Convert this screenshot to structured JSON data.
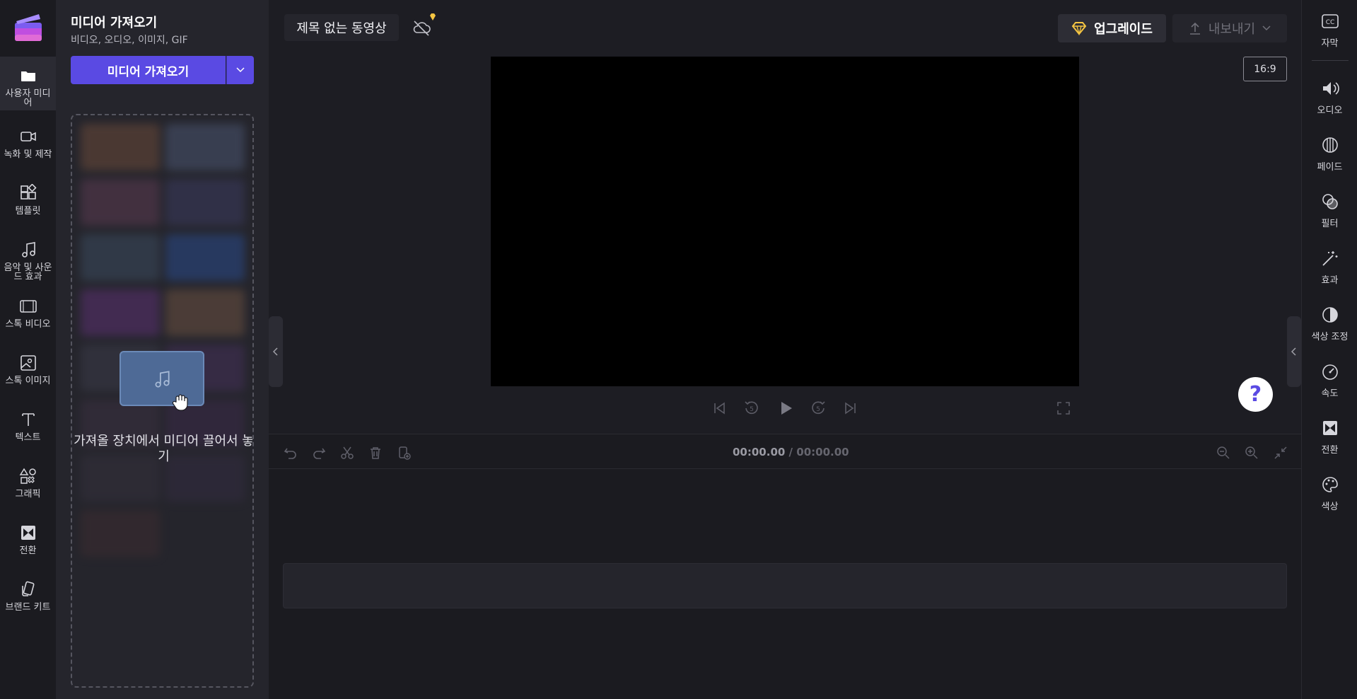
{
  "left_rail": {
    "items": [
      {
        "label": "사용자 미디어",
        "icon": "folder-icon"
      },
      {
        "label": "녹화 및 제작",
        "icon": "video-camera-icon"
      },
      {
        "label": "템플릿",
        "icon": "templates-icon"
      },
      {
        "label": "음악 및 사운드 효과",
        "icon": "music-note-icon"
      },
      {
        "label": "스톡 비디오",
        "icon": "film-icon"
      },
      {
        "label": "스톡 이미지",
        "icon": "image-icon"
      },
      {
        "label": "텍스트",
        "icon": "text-icon"
      },
      {
        "label": "그래픽",
        "icon": "shapes-icon"
      },
      {
        "label": "전환",
        "icon": "transition-icon"
      },
      {
        "label": "브랜드 키트",
        "icon": "brand-kit-icon"
      }
    ]
  },
  "media_panel": {
    "title": "미디어 가져오기",
    "subtitle": "비디오, 오디오, 이미지, GIF",
    "import_button": "미디어 가져오기",
    "drop_text": "가져올 장치에서 미디어 끌어서 놓기"
  },
  "header": {
    "project_title": "제목 없는 동영상",
    "upgrade_label": "업그레이드",
    "export_label": "내보내기"
  },
  "preview": {
    "aspect_ratio": "16:9",
    "help": "?"
  },
  "timeline": {
    "current_time": "00:00.00",
    "separator": " / ",
    "total_time": "00:00.00"
  },
  "right_rail": {
    "items": [
      {
        "label": "자막",
        "icon": "captions-icon"
      },
      {
        "label": "오디오",
        "icon": "speaker-icon"
      },
      {
        "label": "페이드",
        "icon": "fade-icon"
      },
      {
        "label": "필터",
        "icon": "filter-icon"
      },
      {
        "label": "효과",
        "icon": "magic-wand-icon"
      },
      {
        "label": "색상 조정",
        "icon": "contrast-icon"
      },
      {
        "label": "속도",
        "icon": "speedometer-icon"
      },
      {
        "label": "전환",
        "icon": "transition-icon"
      },
      {
        "label": "색상",
        "icon": "palette-icon"
      }
    ]
  },
  "colors": {
    "accent": "#5a4ae3",
    "background": "#1d1d23",
    "panel": "#25252c",
    "gem": "#f5c542"
  }
}
